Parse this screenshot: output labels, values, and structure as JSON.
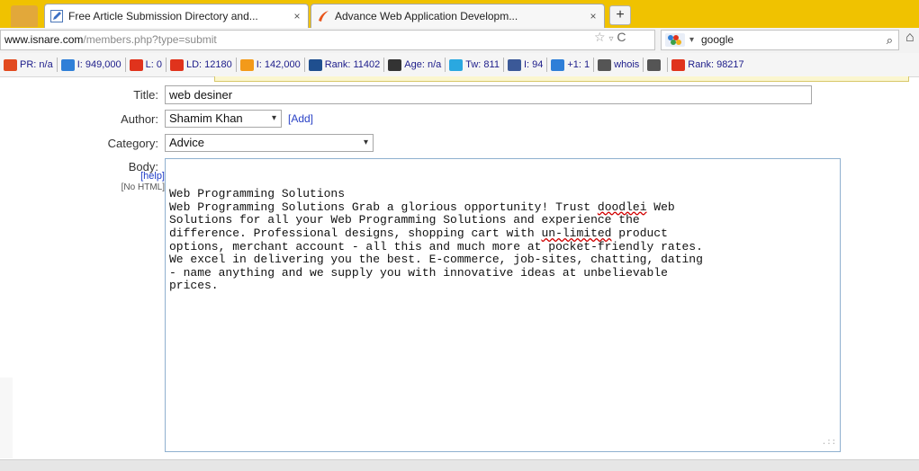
{
  "tabs": [
    {
      "title": "Free Article Submission Directory and...",
      "close": "×",
      "active": true
    },
    {
      "title": "Advance Web Application Developm...",
      "close": "×",
      "active": false
    }
  ],
  "new_tab": "+",
  "address": {
    "host": "www.isnare.com",
    "path": "/members.php?type=submit"
  },
  "search": {
    "query": "google",
    "drop": "▾"
  },
  "seo": [
    {
      "icon": "pagerank-icon",
      "color": "#e24a1e",
      "text": "PR: n/a"
    },
    {
      "icon": "google-index-icon",
      "color": "#2f7fd8",
      "text": "I: 949,000"
    },
    {
      "icon": "links-icon",
      "color": "#e0331c",
      "text": "L: 0"
    },
    {
      "icon": "linkdomain-icon",
      "color": "#e0331c",
      "text": "LD: 12180"
    },
    {
      "icon": "bing-index-icon",
      "color": "#f39a1a",
      "text": "I: 142,000"
    },
    {
      "icon": "alexa-rank-icon",
      "color": "#1f4f8f",
      "text": "Rank: 11402"
    },
    {
      "icon": "archive-icon",
      "color": "#333333",
      "text": "Age: n/a"
    },
    {
      "icon": "twitter-icon",
      "color": "#2aa8e0",
      "text": "Tw: 811"
    },
    {
      "icon": "facebook-icon",
      "color": "#3b5998",
      "text": "I: 94"
    },
    {
      "icon": "google-plus-icon",
      "color": "#2f7fd8",
      "text": "+1: 1"
    },
    {
      "icon": "whois-icon",
      "color": "#555555",
      "text": "whois"
    },
    {
      "icon": "source-icon",
      "color": "#555555",
      "text": ""
    },
    {
      "icon": "rank2-icon",
      "color": "#e0331c",
      "text": "Rank: 98217"
    }
  ],
  "form": {
    "title_label": "Title:",
    "title_value": "web desiner",
    "author_label": "Author:",
    "author_value": "Shamim Khan",
    "add_link": "[Add]",
    "category_label": "Category:",
    "category_value": "Advice",
    "body_label": "Body:",
    "help_link": "[help]",
    "no_html": "[No HTML]",
    "body_lines": [
      "Web Programming Solutions",
      "Web Programming Solutions Grab a glorious opportunity! Trust doodlei Web",
      "Solutions for all your Web Programming Solutions and experience the",
      "difference. Professional designs, shopping cart with un-limited product",
      "options, merchant account - all this and much more at pocket-friendly rates.",
      "We excel in delivering you the best. E-commerce, job-sites, chatting, dating",
      "- name anything and we supply you with innovative ideas at unbelievable",
      "prices."
    ]
  }
}
